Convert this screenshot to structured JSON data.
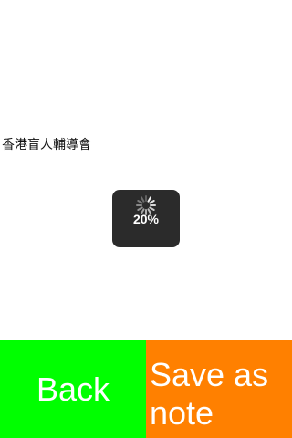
{
  "title": "香港盲人輔導會",
  "loading": {
    "percent_label": "20%",
    "progress": 0.2,
    "icon": "activity-spinner-icon"
  },
  "buttons": {
    "back_label": "Back",
    "save_label": "Save as note"
  },
  "colors": {
    "back_bg": "#00ff00",
    "save_bg": "#ff8000",
    "hud_bg": "#2b2b2b",
    "button_text": "#ffffff"
  }
}
